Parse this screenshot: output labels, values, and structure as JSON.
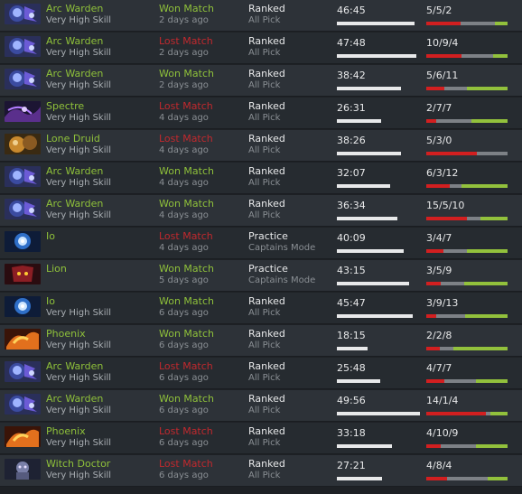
{
  "colors": {
    "won": "#8fc13a",
    "lost": "#c1292e",
    "kills": "#d21f20",
    "deaths": "#7d8186",
    "assists": "#92c13c",
    "duration_bar": "#e8e9ea"
  },
  "matches": [
    {
      "hero": "Arc Warden",
      "hero_icon": "arc-warden-portrait",
      "skill": "Very High Skill",
      "result": "Won Match",
      "outcome": "won",
      "when": "2 days ago",
      "lobby": "Ranked",
      "mode": "All Pick",
      "duration": "46:45",
      "kda": "5/5/2",
      "kills": 5,
      "deaths": 5,
      "assists": 2
    },
    {
      "hero": "Arc Warden",
      "hero_icon": "arc-warden-portrait",
      "skill": "Very High Skill",
      "result": "Lost Match",
      "outcome": "lost",
      "when": "2 days ago",
      "lobby": "Ranked",
      "mode": "All Pick",
      "duration": "47:48",
      "kda": "10/9/4",
      "kills": 10,
      "deaths": 9,
      "assists": 4
    },
    {
      "hero": "Arc Warden",
      "hero_icon": "arc-warden-portrait",
      "skill": "Very High Skill",
      "result": "Won Match",
      "outcome": "won",
      "when": "2 days ago",
      "lobby": "Ranked",
      "mode": "All Pick",
      "duration": "38:42",
      "kda": "5/6/11",
      "kills": 5,
      "deaths": 6,
      "assists": 11
    },
    {
      "hero": "Spectre",
      "hero_icon": "spectre-portrait",
      "skill": "Very High Skill",
      "result": "Lost Match",
      "outcome": "lost",
      "when": "4 days ago",
      "lobby": "Ranked",
      "mode": "All Pick",
      "duration": "26:31",
      "kda": "2/7/7",
      "kills": 2,
      "deaths": 7,
      "assists": 7
    },
    {
      "hero": "Lone Druid",
      "hero_icon": "lone-druid-portrait",
      "skill": "Very High Skill",
      "result": "Lost Match",
      "outcome": "lost",
      "when": "4 days ago",
      "lobby": "Ranked",
      "mode": "All Pick",
      "duration": "38:26",
      "kda": "5/3/0",
      "kills": 5,
      "deaths": 3,
      "assists": 0
    },
    {
      "hero": "Arc Warden",
      "hero_icon": "arc-warden-portrait",
      "skill": "Very High Skill",
      "result": "Won Match",
      "outcome": "won",
      "when": "4 days ago",
      "lobby": "Ranked",
      "mode": "All Pick",
      "duration": "32:07",
      "kda": "6/3/12",
      "kills": 6,
      "deaths": 3,
      "assists": 12
    },
    {
      "hero": "Arc Warden",
      "hero_icon": "arc-warden-portrait",
      "skill": "Very High Skill",
      "result": "Won Match",
      "outcome": "won",
      "when": "4 days ago",
      "lobby": "Ranked",
      "mode": "All Pick",
      "duration": "36:34",
      "kda": "15/5/10",
      "kills": 15,
      "deaths": 5,
      "assists": 10
    },
    {
      "hero": "Io",
      "hero_icon": "io-portrait",
      "skill": "",
      "result": "Lost Match",
      "outcome": "lost",
      "when": "4 days ago",
      "lobby": "Practice",
      "mode": "Captains Mode",
      "duration": "40:09",
      "kda": "3/4/7",
      "kills": 3,
      "deaths": 4,
      "assists": 7
    },
    {
      "hero": "Lion",
      "hero_icon": "lion-portrait",
      "skill": "",
      "result": "Won Match",
      "outcome": "won",
      "when": "5 days ago",
      "lobby": "Practice",
      "mode": "Captains Mode",
      "duration": "43:15",
      "kda": "3/5/9",
      "kills": 3,
      "deaths": 5,
      "assists": 9
    },
    {
      "hero": "Io",
      "hero_icon": "io-portrait",
      "skill": "Very High Skill",
      "result": "Won Match",
      "outcome": "won",
      "when": "6 days ago",
      "lobby": "Ranked",
      "mode": "All Pick",
      "duration": "45:47",
      "kda": "3/9/13",
      "kills": 3,
      "deaths": 9,
      "assists": 13
    },
    {
      "hero": "Phoenix",
      "hero_icon": "phoenix-portrait",
      "skill": "Very High Skill",
      "result": "Won Match",
      "outcome": "won",
      "when": "6 days ago",
      "lobby": "Ranked",
      "mode": "All Pick",
      "duration": "18:15",
      "kda": "2/2/8",
      "kills": 2,
      "deaths": 2,
      "assists": 8
    },
    {
      "hero": "Arc Warden",
      "hero_icon": "arc-warden-portrait",
      "skill": "Very High Skill",
      "result": "Lost Match",
      "outcome": "lost",
      "when": "6 days ago",
      "lobby": "Ranked",
      "mode": "All Pick",
      "duration": "25:48",
      "kda": "4/7/7",
      "kills": 4,
      "deaths": 7,
      "assists": 7
    },
    {
      "hero": "Arc Warden",
      "hero_icon": "arc-warden-portrait",
      "skill": "Very High Skill",
      "result": "Won Match",
      "outcome": "won",
      "when": "6 days ago",
      "lobby": "Ranked",
      "mode": "All Pick",
      "duration": "49:56",
      "kda": "14/1/4",
      "kills": 14,
      "deaths": 1,
      "assists": 4
    },
    {
      "hero": "Phoenix",
      "hero_icon": "phoenix-portrait",
      "skill": "Very High Skill",
      "result": "Lost Match",
      "outcome": "lost",
      "when": "6 days ago",
      "lobby": "Ranked",
      "mode": "All Pick",
      "duration": "33:18",
      "kda": "4/10/9",
      "kills": 4,
      "deaths": 10,
      "assists": 9
    },
    {
      "hero": "Witch Doctor",
      "hero_icon": "witch-doctor-portrait",
      "skill": "Very High Skill",
      "result": "Lost Match",
      "outcome": "lost",
      "when": "6 days ago",
      "lobby": "Ranked",
      "mode": "All Pick",
      "duration": "27:21",
      "kda": "4/8/4",
      "kills": 4,
      "deaths": 8,
      "assists": 4
    }
  ]
}
